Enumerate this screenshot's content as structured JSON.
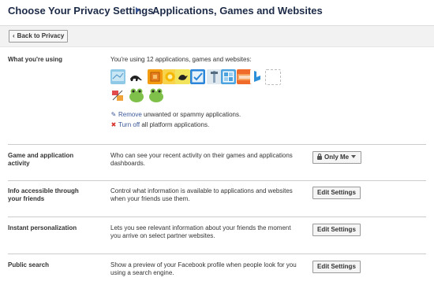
{
  "header": {
    "crumb_primary": "Choose Your Privacy Settings",
    "crumb_secondary": "Applications, Games and Websites"
  },
  "back_button": {
    "label": "Back to Privacy"
  },
  "sections": {
    "what_using": {
      "label": "What you're using",
      "summary": "You're using 12 applications, games and websites:",
      "apps": [
        {
          "name": "map-app-icon",
          "color": "#8fc9e8"
        },
        {
          "name": "anteater-app-icon",
          "color": "#ffffff"
        },
        {
          "name": "orange-cube-app-icon",
          "color": "#f39c12"
        },
        {
          "name": "yellow-app-icon",
          "color": "#f7d44c"
        },
        {
          "name": "blackbird-app-icon",
          "color": "#f2e35c"
        },
        {
          "name": "checkmark-app-icon",
          "color": "#2b86d9"
        },
        {
          "name": "tool-app-icon",
          "color": "#dfe7ef"
        },
        {
          "name": "foursquare-app-icon",
          "color": "#4aa3df"
        },
        {
          "name": "orange-brand-app-icon",
          "color": "#f06a2a"
        },
        {
          "name": "bing-app-icon",
          "color": "#ffffff"
        },
        {
          "name": "blank-app-icon",
          "color": "#ffffff"
        },
        {
          "name": "scissors-app-icon",
          "color": "#e24b4b"
        },
        {
          "name": "frog-app-icon-1",
          "color": "#7fc04b"
        },
        {
          "name": "frog-app-icon-2",
          "color": "#7fc04b"
        }
      ],
      "remove_link": "Remove",
      "remove_text": "unwanted or spammy applications.",
      "turnoff_link": "Turn off",
      "turnoff_text": "all platform applications."
    },
    "game_activity": {
      "label_line1": "Game and application",
      "label_line2": "activity",
      "desc_line1": "Who can see your recent activity on their games and applications",
      "desc_line2": "dashboards.",
      "button": "Only Me"
    },
    "info_accessible": {
      "label_line1": "Info accessible through",
      "label_line2": "your friends",
      "desc_line1": "Control what information is available to applications and websites",
      "desc_line2": "when your friends use them.",
      "button": "Edit Settings"
    },
    "instant_personalization": {
      "label": "Instant personalization",
      "desc_line1": "Lets you see relevant information about your friends the moment",
      "desc_line2": "you arrive on select partner websites.",
      "button": "Edit Settings"
    },
    "public_search": {
      "label": "Public search",
      "desc_line1": "Show a preview of your Facebook profile when people look for you",
      "desc_line2": "using a search engine.",
      "button": "Edit Settings"
    }
  },
  "colors": {
    "link": "#3b5998",
    "heading": "#1c2a47"
  }
}
